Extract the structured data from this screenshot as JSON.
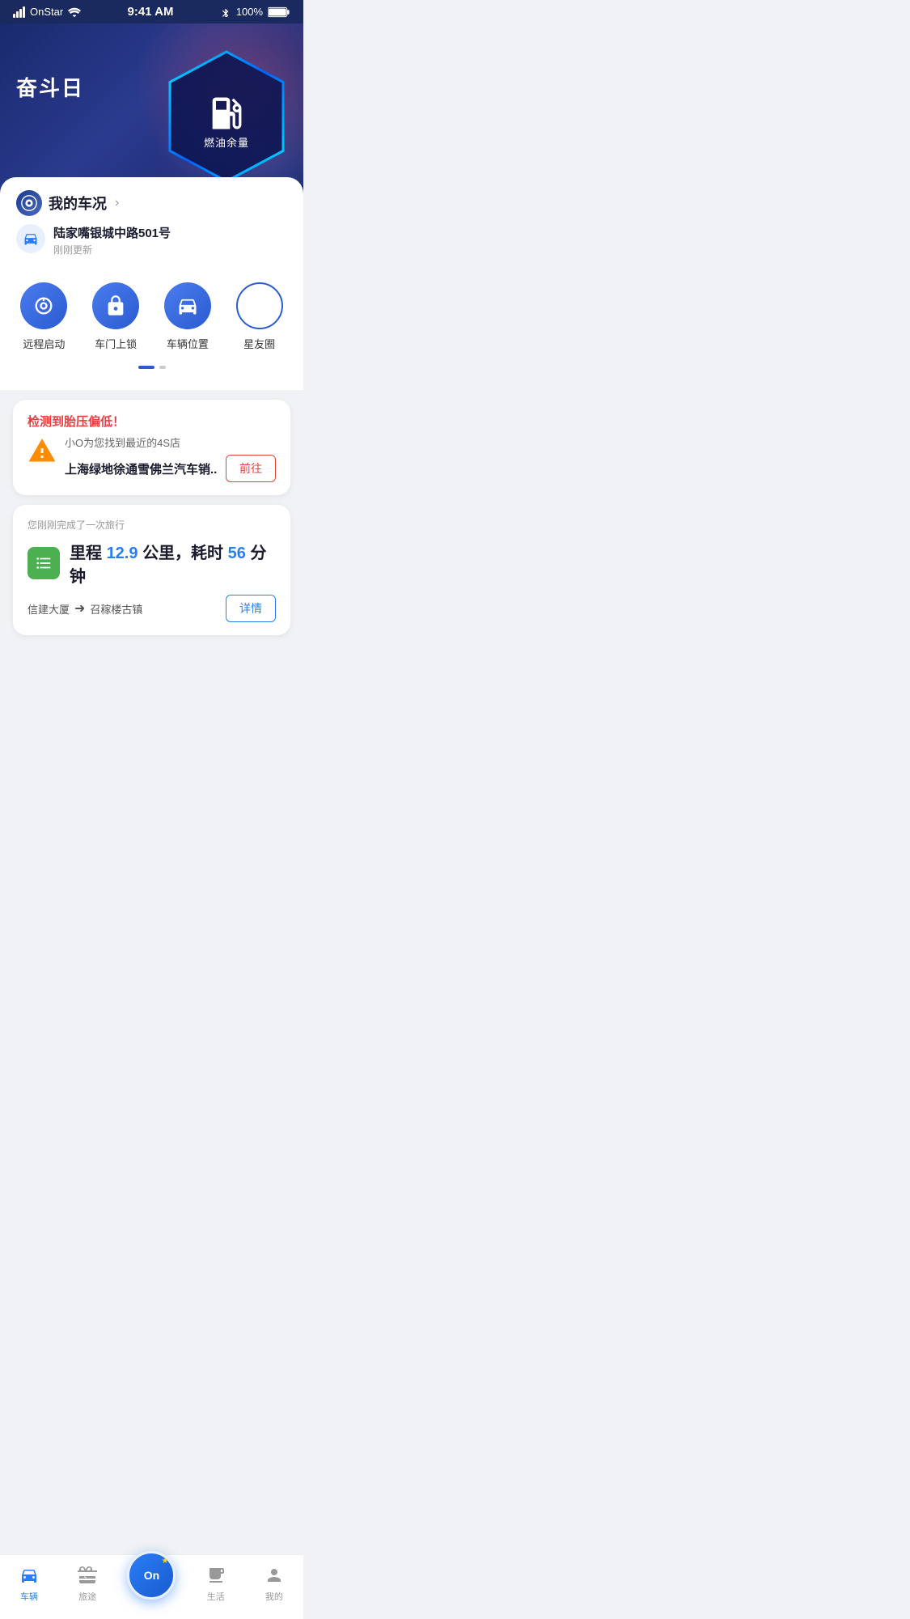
{
  "statusBar": {
    "carrier": "OnStar",
    "time": "9:41 AM",
    "bluetooth": "BT",
    "battery": "100%"
  },
  "hero": {
    "title": "奋斗日",
    "fuelLabel": "燃油余量"
  },
  "carStatus": {
    "label": "我的车况",
    "chevron": "›",
    "locationAddress": "陆家嘴银城中路501号",
    "locationUpdated": "刚刚更新"
  },
  "quickActions": [
    {
      "label": "远程启动",
      "icon": "remote-start"
    },
    {
      "label": "车门上锁",
      "icon": "door-lock"
    },
    {
      "label": "车辆位置",
      "icon": "car-location"
    },
    {
      "label": "星友圈",
      "icon": "star-circle"
    }
  ],
  "alertCard": {
    "title": "检测到胎压偏低！",
    "subtitle": "小O为您找到最近的4S店",
    "shopName": "上海绿地徐通雪佛兰汽车销..",
    "actionLabel": "前往"
  },
  "tripCard": {
    "subtitle": "您刚刚完成了一次旅行",
    "distanceLabel": "里程",
    "distance": "12.9",
    "distanceUnit": "公里，耗时",
    "duration": "56",
    "durationUnit": "分钟",
    "from": "信建大厦",
    "to": "召稼楼古镇",
    "actionLabel": "详情"
  },
  "bottomNav": {
    "items": [
      {
        "label": "车辆",
        "icon": "car-nav",
        "active": true
      },
      {
        "label": "旅途",
        "icon": "trip-nav",
        "active": false
      },
      {
        "label": "",
        "icon": "onstar-center",
        "active": false,
        "center": true
      },
      {
        "label": "生活",
        "icon": "life-nav",
        "active": false
      },
      {
        "label": "我的",
        "icon": "profile-nav",
        "active": false
      }
    ],
    "centerLabel": "On",
    "centerStar": "★"
  }
}
